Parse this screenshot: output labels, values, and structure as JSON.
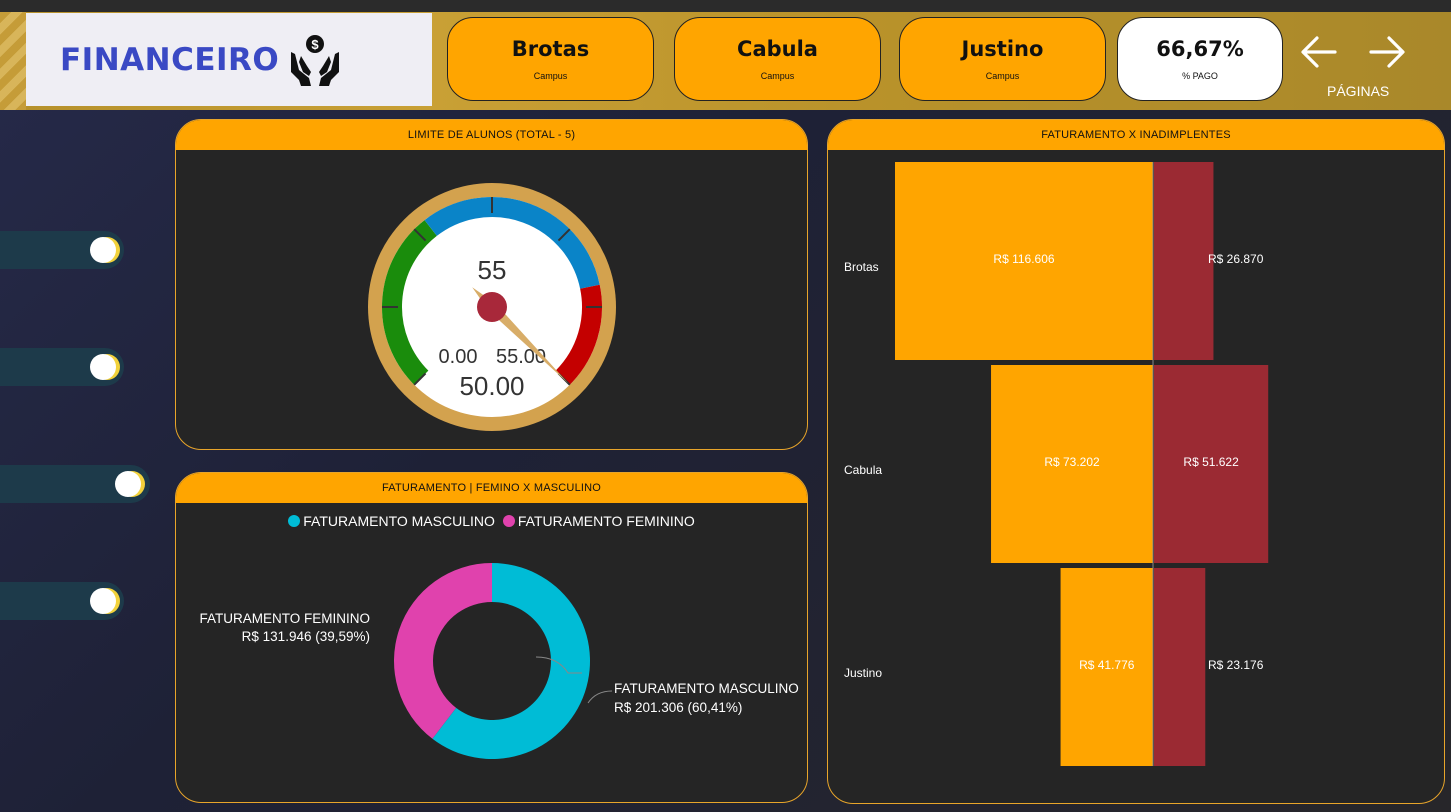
{
  "header": {
    "title": "FINANCEIRO",
    "logo_icon": "hands-money-icon",
    "cards": [
      {
        "value": "Brotas",
        "label": "Campus"
      },
      {
        "value": "Cabula",
        "label": "Campus"
      },
      {
        "value": "Justino",
        "label": "Campus"
      }
    ],
    "pago": {
      "value": "66,67%",
      "label": "% PAGO"
    },
    "nav_label": "PÁGINAS",
    "prev_icon": "arrow-left-icon",
    "next_icon": "arrow-right-icon"
  },
  "sidebar": {
    "toggles": [
      {
        "state": "on"
      },
      {
        "state": "on"
      },
      {
        "state": "on"
      },
      {
        "state": "on"
      }
    ]
  },
  "gauge_panel": {
    "title": "LIMITE DE ALUNOS (TOTAL - 5)",
    "value_label": "55",
    "min_label": "0.00",
    "max_label": "55.00",
    "target_label": "50.00"
  },
  "donut_panel": {
    "title": "FATURAMENTO | FEMINO X MASCULINO",
    "legend": [
      {
        "label": "FATURAMENTO MASCULINO",
        "color": "#00bcd6"
      },
      {
        "label": "FATURAMENTO FEMININO",
        "color": "#e042ad"
      }
    ],
    "labels": {
      "fem_name": "FATURAMENTO FEMININO",
      "fem_value": "R$ 131.946 (39,59%)",
      "masc_name": "FATURAMENTO MASCULINO",
      "masc_value": "R$ 201.306 (60,41%)"
    }
  },
  "bar_panel": {
    "title": "FATURAMENTO X INADIMPLENTES"
  },
  "chart_data": [
    {
      "type": "gauge",
      "title": "LIMITE DE ALUNOS (TOTAL - 5)",
      "value": 55,
      "min": 0,
      "max": 55,
      "target": 50,
      "bands": [
        {
          "color": "#1a8c0c",
          "from": 0,
          "to": 0.36
        },
        {
          "color": "#0a84c8",
          "from": 0.36,
          "to": 0.79
        },
        {
          "color": "#c40000",
          "from": 0.79,
          "to": 1.0
        }
      ]
    },
    {
      "type": "pie",
      "title": "FATURAMENTO | FEMINO X MASCULINO",
      "labels": [
        "FATURAMENTO MASCULINO",
        "FATURAMENTO FEMININO"
      ],
      "values": [
        201306,
        131946
      ],
      "colors": [
        "#00bcd6",
        "#e042ad"
      ]
    },
    {
      "type": "bar",
      "title": "FATURAMENTO X INADIMPLENTES",
      "categories": [
        "Brotas",
        "Cabula",
        "Justino"
      ],
      "series": [
        {
          "values": [
            116606,
            73202,
            41776
          ],
          "labels": [
            "R$ 116.606",
            "R$ 73.202",
            "R$ 41.776"
          ],
          "color": "#ffa500"
        },
        {
          "values": [
            26870,
            51622,
            23176
          ],
          "labels": [
            "R$ 26.870",
            "R$ 51.622",
            "R$ 23.176"
          ],
          "color": "#9b2a33"
        }
      ]
    }
  ]
}
